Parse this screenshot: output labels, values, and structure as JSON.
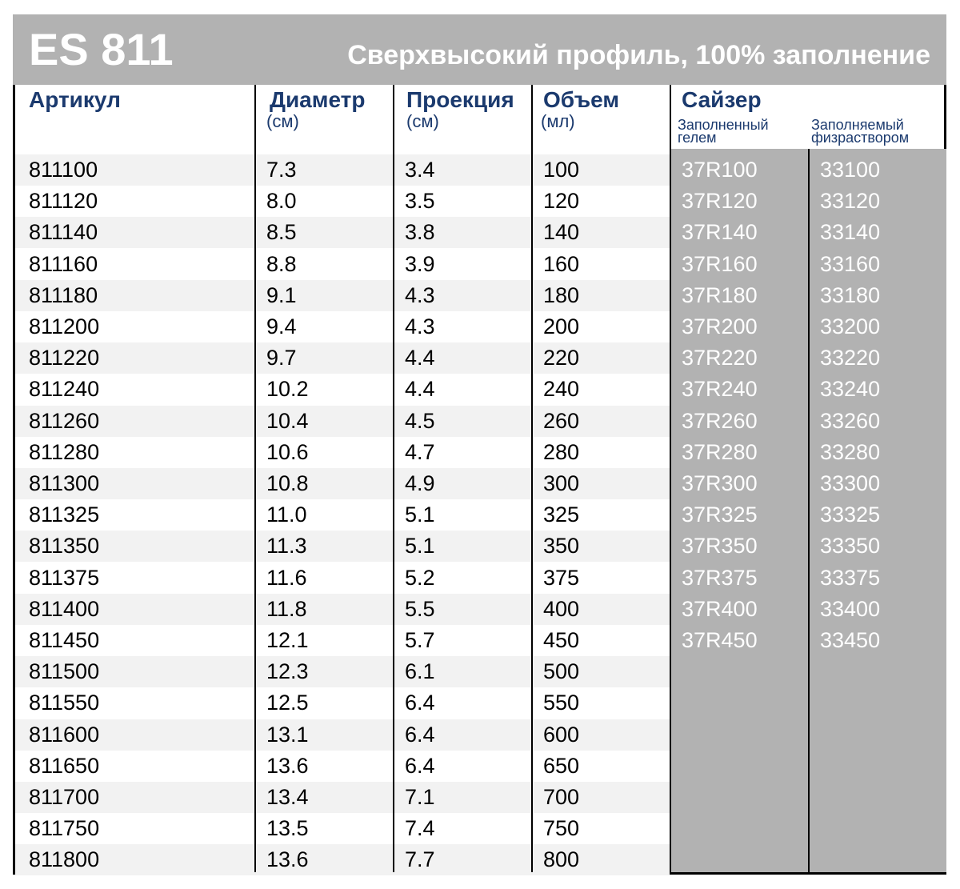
{
  "title": {
    "code": "ES 811",
    "subtitle": "Сверхвысокий профиль, 100% заполнение"
  },
  "headers": {
    "article": "Артикул",
    "diameter": "Диаметр",
    "diameter_unit": "(см)",
    "projection": "Проекция",
    "projection_unit": "(см)",
    "volume": "Объем",
    "volume_unit": "(мл)",
    "sizer": "Сайзер",
    "sizer_gel": "Заполненный\n гелем",
    "sizer_saline": "Заполняемый\n физраствором"
  },
  "rows": [
    {
      "article": "811100",
      "diameter": "7.3",
      "projection": "3.4",
      "volume": "100",
      "sizer_gel": "37R100",
      "sizer_saline": "33100"
    },
    {
      "article": "811120",
      "diameter": "8.0",
      "projection": "3.5",
      "volume": "120",
      "sizer_gel": "37R120",
      "sizer_saline": "33120"
    },
    {
      "article": "811140",
      "diameter": "8.5",
      "projection": "3.8",
      "volume": "140",
      "sizer_gel": "37R140",
      "sizer_saline": "33140"
    },
    {
      "article": "811160",
      "diameter": "8.8",
      "projection": "3.9",
      "volume": "160",
      "sizer_gel": "37R160",
      "sizer_saline": "33160"
    },
    {
      "article": "811180",
      "diameter": "9.1",
      "projection": "4.3",
      "volume": "180",
      "sizer_gel": "37R180",
      "sizer_saline": "33180"
    },
    {
      "article": "811200",
      "diameter": "9.4",
      "projection": "4.3",
      "volume": "200",
      "sizer_gel": "37R200",
      "sizer_saline": "33200"
    },
    {
      "article": "811220",
      "diameter": "9.7",
      "projection": "4.4",
      "volume": "220",
      "sizer_gel": "37R220",
      "sizer_saline": "33220"
    },
    {
      "article": "811240",
      "diameter": "10.2",
      "projection": "4.4",
      "volume": "240",
      "sizer_gel": "37R240",
      "sizer_saline": "33240"
    },
    {
      "article": "811260",
      "diameter": "10.4",
      "projection": "4.5",
      "volume": "260",
      "sizer_gel": "37R260",
      "sizer_saline": "33260"
    },
    {
      "article": "811280",
      "diameter": "10.6",
      "projection": "4.7",
      "volume": "280",
      "sizer_gel": "37R280",
      "sizer_saline": "33280"
    },
    {
      "article": "811300",
      "diameter": "10.8",
      "projection": "4.9",
      "volume": "300",
      "sizer_gel": "37R300",
      "sizer_saline": "33300"
    },
    {
      "article": "811325",
      "diameter": "11.0",
      "projection": "5.1",
      "volume": "325",
      "sizer_gel": "37R325",
      "sizer_saline": "33325"
    },
    {
      "article": "811350",
      "diameter": "11.3",
      "projection": "5.1",
      "volume": "350",
      "sizer_gel": "37R350",
      "sizer_saline": "33350"
    },
    {
      "article": "811375",
      "diameter": "11.6",
      "projection": "5.2",
      "volume": "375",
      "sizer_gel": "37R375",
      "sizer_saline": "33375"
    },
    {
      "article": "811400",
      "diameter": "11.8",
      "projection": "5.5",
      "volume": "400",
      "sizer_gel": "37R400",
      "sizer_saline": "33400"
    },
    {
      "article": "811450",
      "diameter": "12.1",
      "projection": "5.7",
      "volume": "450",
      "sizer_gel": "37R450",
      "sizer_saline": "33450"
    },
    {
      "article": "811500",
      "diameter": "12.3",
      "projection": "6.1",
      "volume": "500",
      "sizer_gel": "",
      "sizer_saline": ""
    },
    {
      "article": "811550",
      "diameter": "12.5",
      "projection": "6.4",
      "volume": "550",
      "sizer_gel": "",
      "sizer_saline": ""
    },
    {
      "article": "811600",
      "diameter": "13.1",
      "projection": "6.4",
      "volume": "600",
      "sizer_gel": "",
      "sizer_saline": ""
    },
    {
      "article": "811650",
      "diameter": "13.6",
      "projection": "6.4",
      "volume": "650",
      "sizer_gel": "",
      "sizer_saline": ""
    },
    {
      "article": "811700",
      "diameter": "13.4",
      "projection": "7.1",
      "volume": "700",
      "sizer_gel": "",
      "sizer_saline": ""
    },
    {
      "article": "811750",
      "diameter": "13.5",
      "projection": "7.4",
      "volume": "750",
      "sizer_gel": "",
      "sizer_saline": ""
    },
    {
      "article": "811800",
      "diameter": "13.6",
      "projection": "7.7",
      "volume": "800",
      "sizer_gel": "",
      "sizer_saline": ""
    }
  ]
}
